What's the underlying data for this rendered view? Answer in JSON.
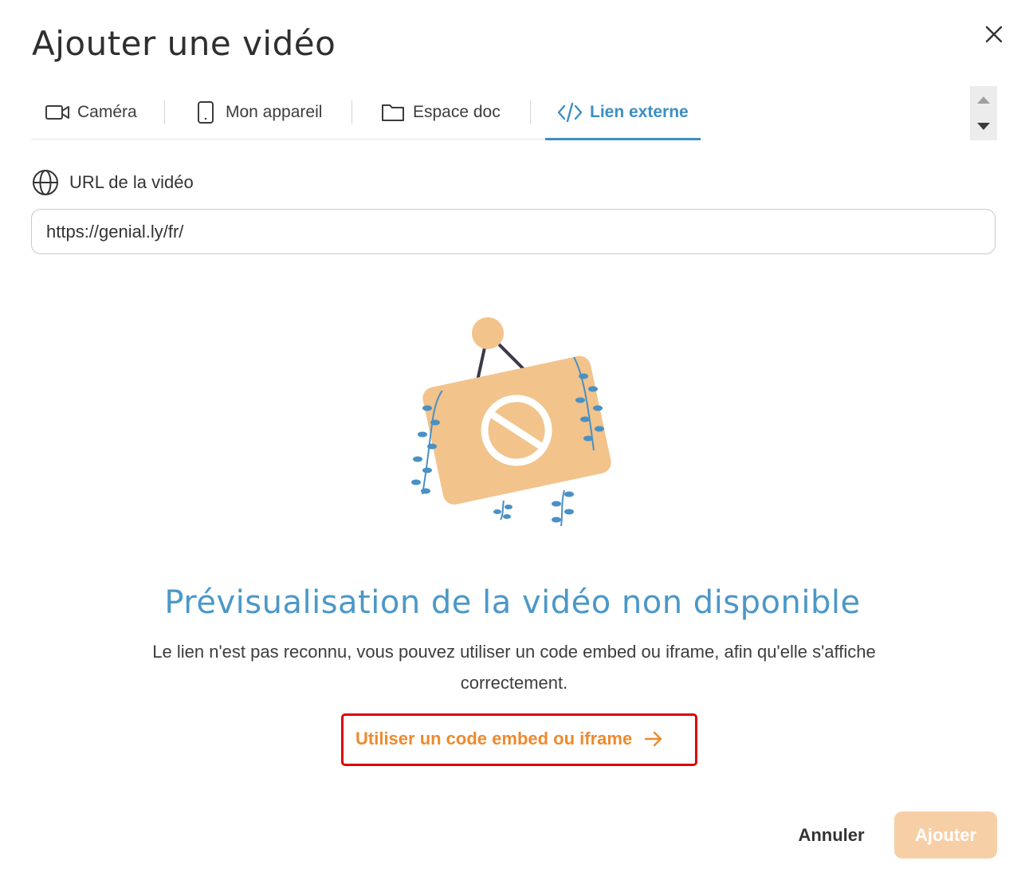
{
  "dialog": {
    "title": "Ajouter une vidéo",
    "close_icon": "close-icon"
  },
  "tabs": [
    {
      "label": "Caméra",
      "icon": "camera-icon",
      "active": false
    },
    {
      "label": "Mon appareil",
      "icon": "phone-icon",
      "active": false
    },
    {
      "label": "Espace doc",
      "icon": "folder-icon",
      "active": false
    },
    {
      "label": "Lien externe",
      "icon": "code-icon",
      "active": true
    }
  ],
  "url_field": {
    "label": "URL de la vidéo",
    "icon": "globe-icon",
    "value": "https://genial.ly/fr/"
  },
  "preview": {
    "illustration": "no-entry-sign-illustration",
    "headline": "Prévisualisation de la vidéo non disponible",
    "description": "Le lien n'est pas reconnu, vous pouvez utiliser un code embed ou iframe, afin qu'elle s'affiche correctement.",
    "embed_link_label": "Utiliser un code embed ou iframe"
  },
  "footer": {
    "cancel_label": "Annuler",
    "add_label": "Ajouter"
  },
  "colors": {
    "accent_blue": "#3c8fc4",
    "accent_orange": "#ee8a2e",
    "add_button_disabled": "#f7cfa6",
    "highlight_box": "#e00000",
    "sign_fill": "#f2c38b",
    "leaf_blue": "#4a90c4"
  }
}
